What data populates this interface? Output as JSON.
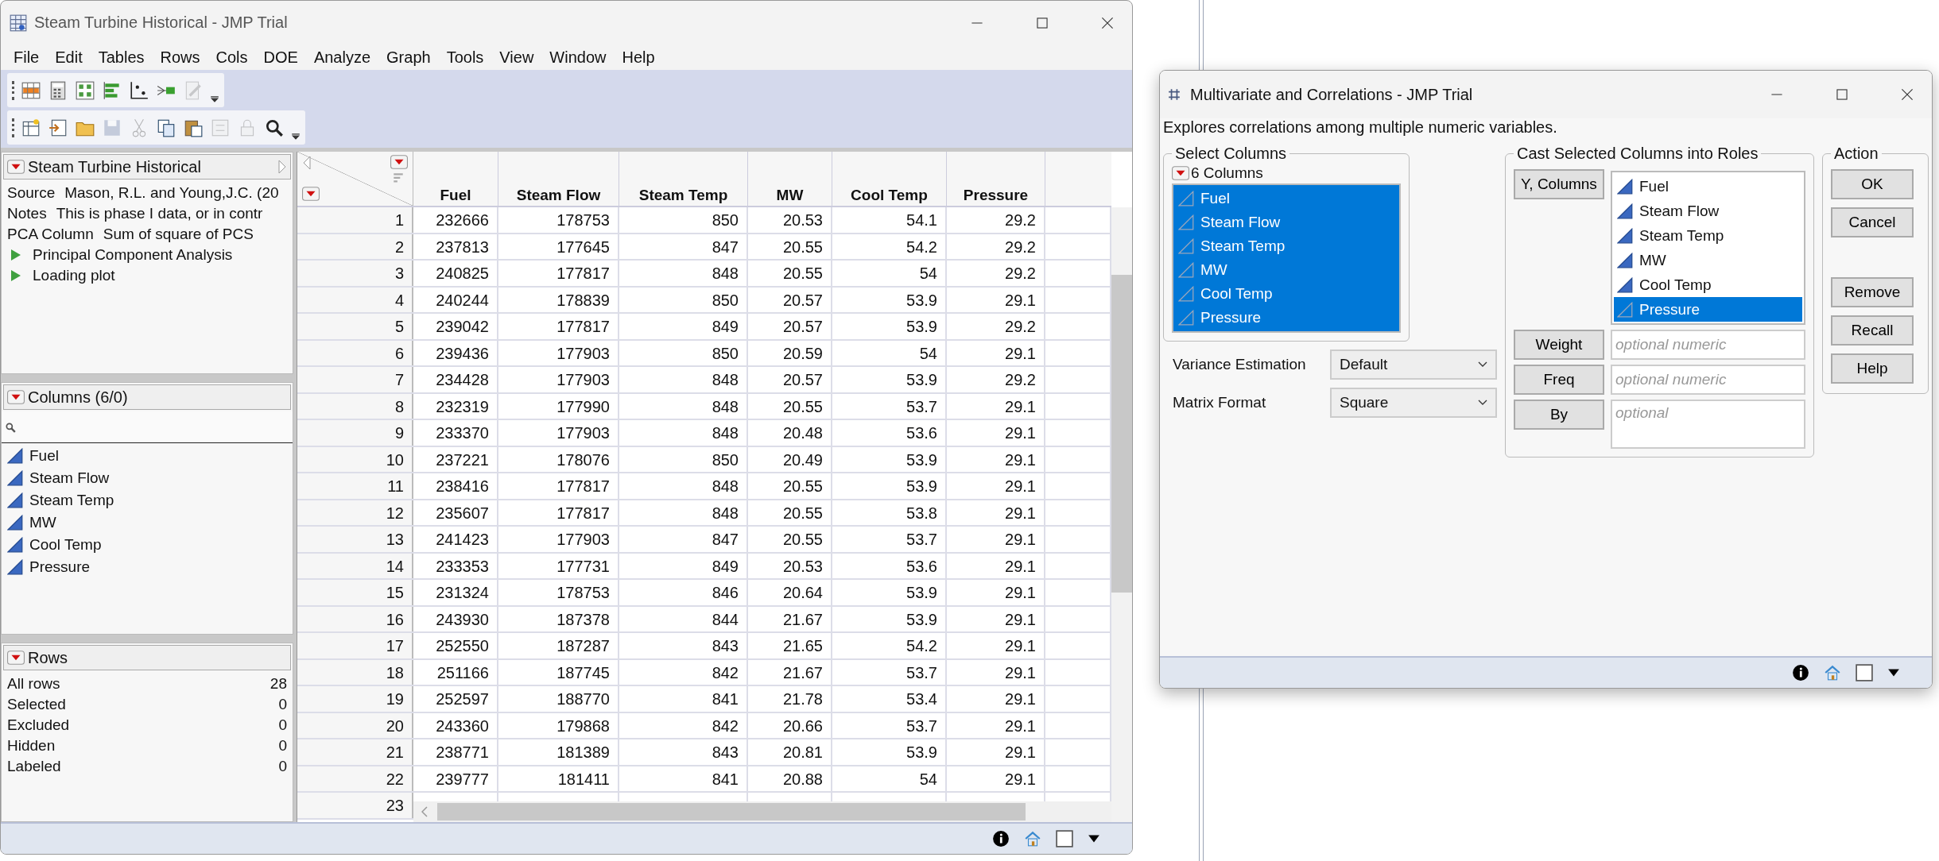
{
  "main_window": {
    "title": "Steam Turbine Historical - JMP Trial",
    "menu": [
      "File",
      "Edit",
      "Tables",
      "Rows",
      "Cols",
      "DOE",
      "Analyze",
      "Graph",
      "Tools",
      "View",
      "Window",
      "Help"
    ],
    "toolbar_1": [
      {
        "kind": "table",
        "disabled": false
      },
      {
        "kind": "calc",
        "disabled": false
      },
      {
        "kind": "grid",
        "disabled": false
      },
      {
        "kind": "bars",
        "disabled": false
      },
      {
        "kind": "yx",
        "disabled": false
      },
      {
        "kind": "arrow",
        "disabled": false
      },
      {
        "kind": "pencil",
        "disabled": true
      }
    ],
    "toolbar_2": [
      {
        "kind": "new",
        "disabled": false
      },
      {
        "kind": "import",
        "disabled": false
      },
      {
        "kind": "folder",
        "disabled": false
      },
      {
        "kind": "save",
        "disabled": true
      },
      {
        "kind": "cut",
        "disabled": true
      },
      {
        "kind": "copy",
        "disabled": false
      },
      {
        "kind": "paste",
        "disabled": false
      },
      {
        "kind": "script",
        "disabled": true
      },
      {
        "kind": "lock",
        "disabled": true
      },
      {
        "kind": "search",
        "disabled": false
      }
    ]
  },
  "table_panel": {
    "title": "Steam Turbine Historical",
    "properties": [
      {
        "name": "Source",
        "value": "Mason, R.L. and Young,J.C. (20"
      },
      {
        "name": "Notes",
        "value": "This is phase I data, or in contr"
      },
      {
        "name": "PCA Column",
        "value": "Sum of square of PCS"
      }
    ],
    "scripts": [
      "Principal Component Analysis",
      "Loading plot"
    ]
  },
  "columns_panel": {
    "title": "Columns (6/0)",
    "items": [
      "Fuel",
      "Steam Flow",
      "Steam Temp",
      "MW",
      "Cool Temp",
      "Pressure"
    ]
  },
  "rows_panel": {
    "title": "Rows",
    "stats": [
      {
        "label": "All rows",
        "value": "28"
      },
      {
        "label": "Selected",
        "value": "0"
      },
      {
        "label": "Excluded",
        "value": "0"
      },
      {
        "label": "Hidden",
        "value": "0"
      },
      {
        "label": "Labeled",
        "value": "0"
      }
    ]
  },
  "table": {
    "columns": [
      "Fuel",
      "Steam Flow",
      "Steam Temp",
      "MW",
      "Cool Temp",
      "Pressure"
    ],
    "rows": [
      {
        "n": "1",
        "cells": [
          "232666",
          "178753",
          "850",
          "20.53",
          "54.1",
          "29.2"
        ]
      },
      {
        "n": "2",
        "cells": [
          "237813",
          "177645",
          "847",
          "20.55",
          "54.2",
          "29.2"
        ]
      },
      {
        "n": "3",
        "cells": [
          "240825",
          "177817",
          "848",
          "20.55",
          "54",
          "29.2"
        ]
      },
      {
        "n": "4",
        "cells": [
          "240244",
          "178839",
          "850",
          "20.57",
          "53.9",
          "29.1"
        ]
      },
      {
        "n": "5",
        "cells": [
          "239042",
          "177817",
          "849",
          "20.57",
          "53.9",
          "29.2"
        ]
      },
      {
        "n": "6",
        "cells": [
          "239436",
          "177903",
          "850",
          "20.59",
          "54",
          "29.1"
        ]
      },
      {
        "n": "7",
        "cells": [
          "234428",
          "177903",
          "848",
          "20.57",
          "53.9",
          "29.2"
        ]
      },
      {
        "n": "8",
        "cells": [
          "232319",
          "177990",
          "848",
          "20.55",
          "53.7",
          "29.1"
        ]
      },
      {
        "n": "9",
        "cells": [
          "233370",
          "177903",
          "848",
          "20.48",
          "53.6",
          "29.1"
        ]
      },
      {
        "n": "10",
        "cells": [
          "237221",
          "178076",
          "850",
          "20.49",
          "53.9",
          "29.1"
        ]
      },
      {
        "n": "11",
        "cells": [
          "238416",
          "177817",
          "848",
          "20.55",
          "53.9",
          "29.1"
        ]
      },
      {
        "n": "12",
        "cells": [
          "235607",
          "177817",
          "848",
          "20.55",
          "53.8",
          "29.1"
        ]
      },
      {
        "n": "13",
        "cells": [
          "241423",
          "177903",
          "847",
          "20.55",
          "53.7",
          "29.1"
        ]
      },
      {
        "n": "14",
        "cells": [
          "233353",
          "177731",
          "849",
          "20.53",
          "53.6",
          "29.1"
        ]
      },
      {
        "n": "15",
        "cells": [
          "231324",
          "178753",
          "846",
          "20.64",
          "53.9",
          "29.1"
        ]
      },
      {
        "n": "16",
        "cells": [
          "243930",
          "187378",
          "844",
          "21.67",
          "53.9",
          "29.1"
        ]
      },
      {
        "n": "17",
        "cells": [
          "252550",
          "187287",
          "843",
          "21.65",
          "54.2",
          "29.1"
        ]
      },
      {
        "n": "18",
        "cells": [
          "251166",
          "187745",
          "842",
          "21.67",
          "53.7",
          "29.1"
        ]
      },
      {
        "n": "19",
        "cells": [
          "252597",
          "188770",
          "841",
          "21.78",
          "53.4",
          "29.1"
        ]
      },
      {
        "n": "20",
        "cells": [
          "243360",
          "179868",
          "842",
          "20.66",
          "53.7",
          "29.1"
        ]
      },
      {
        "n": "21",
        "cells": [
          "238771",
          "181389",
          "843",
          "20.81",
          "53.9",
          "29.1"
        ]
      },
      {
        "n": "22",
        "cells": [
          "239777",
          "181411",
          "841",
          "20.88",
          "54",
          "29.1"
        ]
      },
      {
        "n": "23",
        "cells": []
      }
    ]
  },
  "dialog": {
    "title": "Multivariate and Correlations - JMP Trial",
    "description": "Explores correlations among multiple numeric variables.",
    "select_columns": {
      "title": "Select Columns",
      "count": "6 Columns",
      "items": [
        {
          "label": "Fuel",
          "selected": true
        },
        {
          "label": "Steam Flow",
          "selected": true
        },
        {
          "label": "Steam Temp",
          "selected": true
        },
        {
          "label": "MW",
          "selected": true
        },
        {
          "label": "Cool Temp",
          "selected": true
        },
        {
          "label": "Pressure",
          "selected": true
        }
      ]
    },
    "options": [
      {
        "label": "Variance Estimation",
        "value": "Default"
      },
      {
        "label": "Matrix Format",
        "value": "Square"
      }
    ],
    "cast": {
      "title": "Cast Selected Columns into Roles",
      "roles": [
        {
          "kind": "list",
          "button": "Y, Columns",
          "items": [
            {
              "label": "Fuel",
              "selected": false
            },
            {
              "label": "Steam Flow",
              "selected": false
            },
            {
              "label": "Steam Temp",
              "selected": false
            },
            {
              "label": "MW",
              "selected": false
            },
            {
              "label": "Cool Temp",
              "selected": false
            },
            {
              "label": "Pressure",
              "selected": true
            }
          ]
        },
        {
          "kind": "field",
          "button": "Weight",
          "placeholder": "optional numeric"
        },
        {
          "kind": "field",
          "button": "Freq",
          "placeholder": "optional numeric"
        },
        {
          "kind": "tall",
          "button": "By",
          "placeholder": "optional"
        }
      ]
    },
    "action": {
      "title": "Action",
      "buttons": [
        {
          "label": "OK",
          "kind": "top"
        },
        {
          "label": "Cancel",
          "kind": "top"
        },
        {
          "label": "Remove",
          "kind": "bottom"
        },
        {
          "label": "Recall",
          "kind": "bottom"
        },
        {
          "label": "Help",
          "kind": "bottom"
        }
      ]
    }
  }
}
